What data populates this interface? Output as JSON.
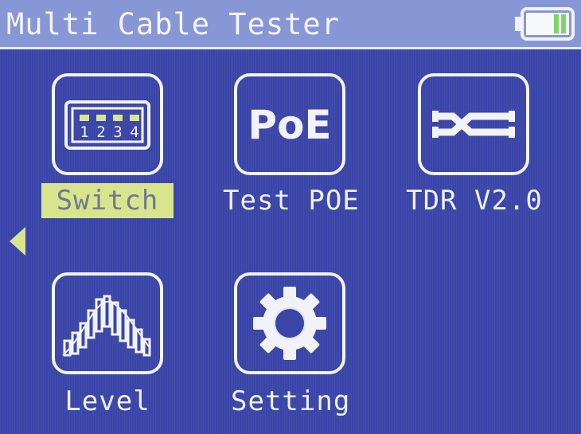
{
  "header": {
    "title": "Multi Cable Tester",
    "battery_icon": "battery-icon",
    "battery_level": 0.4
  },
  "menu": {
    "items": [
      {
        "label": "Switch",
        "icon": "switch-ports-icon",
        "selected": true
      },
      {
        "label": "Test POE",
        "icon": "poe-icon",
        "selected": false
      },
      {
        "label": "TDR V2.0",
        "icon": "tdr-icon",
        "selected": false
      },
      {
        "label": "Level",
        "icon": "level-bars-icon",
        "selected": false
      },
      {
        "label": "Setting",
        "icon": "gear-icon",
        "selected": false
      }
    ],
    "poe_icon_text": "PoE",
    "switch_port_numbers": [
      "1",
      "2",
      "3",
      "4"
    ]
  },
  "colors": {
    "background": "#3a45a8",
    "titlebar": "#8797d6",
    "highlight": "#d9e58c",
    "battery_fill": "#7ed36a"
  }
}
